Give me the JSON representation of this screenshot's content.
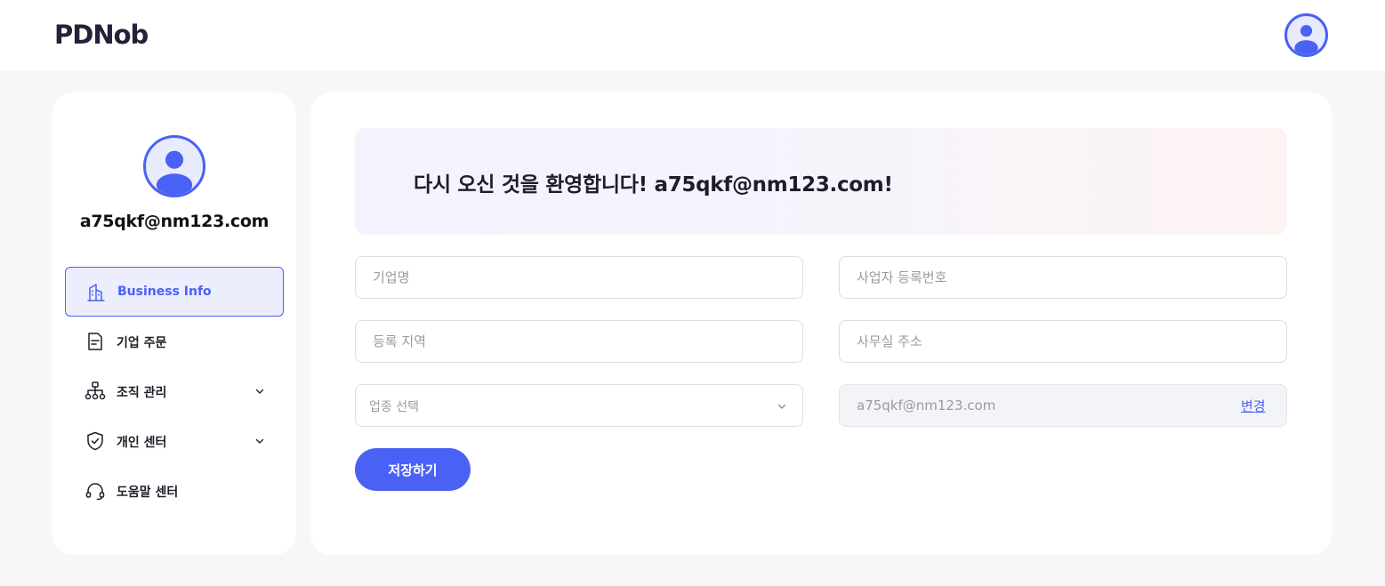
{
  "header": {
    "logo": "PDNob",
    "avatar_icon": "user-avatar-icon"
  },
  "sidebar": {
    "avatar_icon": "user-avatar-icon",
    "email": "a75qkf@nm123.com",
    "items": [
      {
        "label": "Business Info",
        "icon": "building-icon",
        "active": true,
        "has_chevron": false
      },
      {
        "label": "기업 주문",
        "icon": "document-icon",
        "active": false,
        "has_chevron": false
      },
      {
        "label": "조직 관리",
        "icon": "org-chart-icon",
        "active": false,
        "has_chevron": true
      },
      {
        "label": "개인 센터",
        "icon": "shield-check-icon",
        "active": false,
        "has_chevron": true
      },
      {
        "label": "도움말 센터",
        "icon": "headset-icon",
        "active": false,
        "has_chevron": false
      }
    ]
  },
  "main": {
    "welcome": "다시 오신 것을 환영합니다! a75qkf@nm123.com!",
    "form": {
      "company_name_placeholder": "기업명",
      "business_reg_no_placeholder": "사업자 등록번호",
      "region_placeholder": "등록 지역",
      "office_address_placeholder": "사무실 주소",
      "industry_select": "업종 선택",
      "email_value": "a75qkf@nm123.com",
      "change_link": "변경",
      "save_label": "저장하기"
    }
  },
  "colors": {
    "accent": "#4a61f5",
    "background": "#f7f7f8",
    "panel": "#ffffff"
  }
}
